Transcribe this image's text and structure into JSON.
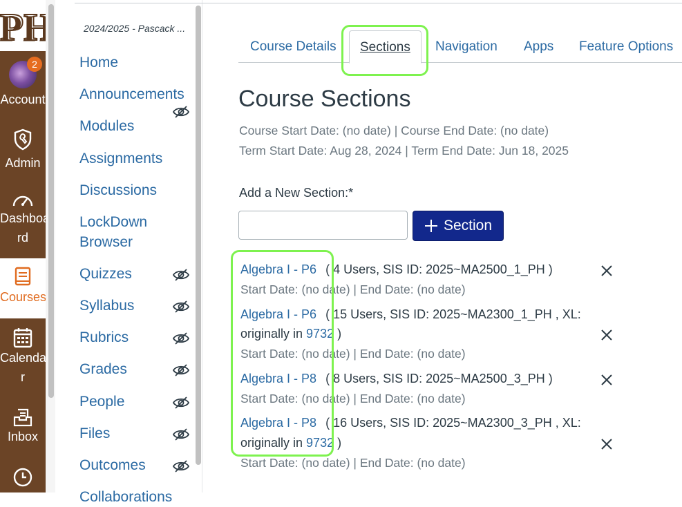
{
  "global_nav": {
    "logo_text": "PH",
    "items": [
      {
        "label": "Account",
        "badge": "2",
        "icon": "avatar"
      },
      {
        "label": "Admin",
        "icon": "shield-icon"
      },
      {
        "label": "Dashboa rd",
        "line1": "Dashboa",
        "line2": "rd",
        "icon": "speedometer-icon"
      },
      {
        "label": "Courses",
        "icon": "book-icon",
        "active": true
      },
      {
        "label": "Calenda r",
        "line1": "Calenda",
        "line2": "r",
        "icon": "calendar-icon"
      },
      {
        "label": "Inbox",
        "icon": "inbox-icon"
      },
      {
        "label": "",
        "icon": "clock-icon"
      }
    ]
  },
  "course_nav": {
    "term": "2024/2025 - Pascack ...",
    "items": [
      {
        "label": "Home",
        "hidden": false
      },
      {
        "label": "Announcements",
        "hidden": true
      },
      {
        "label": "Modules",
        "hidden": false
      },
      {
        "label": "Assignments",
        "hidden": false
      },
      {
        "label": "Discussions",
        "hidden": false
      },
      {
        "label": "LockDown",
        "label2": "Browser",
        "hidden": false
      },
      {
        "label": "Quizzes",
        "hidden": true
      },
      {
        "label": "Syllabus",
        "hidden": true
      },
      {
        "label": "Rubrics",
        "hidden": true
      },
      {
        "label": "Grades",
        "hidden": true
      },
      {
        "label": "People",
        "hidden": true
      },
      {
        "label": "Files",
        "hidden": true
      },
      {
        "label": "Outcomes",
        "hidden": true
      },
      {
        "label": "Collaborations",
        "hidden": false
      }
    ]
  },
  "tabs": [
    {
      "label": "Course Details"
    },
    {
      "label": "Sections",
      "active": true
    },
    {
      "label": "Navigation"
    },
    {
      "label": "Apps"
    },
    {
      "label": "Feature Options"
    }
  ],
  "main": {
    "title": "Course Sections",
    "course_dates": "Course Start Date: (no date) | Course End Date: (no date)",
    "term_dates": "Term Start Date: Aug 28, 2024 | Term End Date: Jun 18, 2025",
    "add_label": "Add a New Section:*",
    "input_value": "",
    "add_button": "Section"
  },
  "sections": [
    {
      "name": "Algebra I - P6",
      "details": "( 4 Users, SIS ID: 2025~MA2500_1_PH )",
      "dates": "Start Date: (no date) | End Date: (no date)"
    },
    {
      "name": "Algebra I - P6",
      "details": "( 15 Users, SIS ID: 2025~MA2300_1_PH , XL:",
      "xl_prefix": "originally in ",
      "xl_link": "9732",
      "xl_suffix": " )",
      "dates": "Start Date: (no date) | End Date: (no date)"
    },
    {
      "name": "Algebra I - P8",
      "details": "( 8 Users, SIS ID: 2025~MA2500_3_PH )",
      "dates": "Start Date: (no date) | End Date: (no date)"
    },
    {
      "name": "Algebra I - P8",
      "details": "( 16 Users, SIS ID: 2025~MA2300_3_PH , XL:",
      "xl_prefix": "originally in ",
      "xl_link": "9732",
      "xl_suffix": " )",
      "dates": "Start Date: (no date) | End Date: (no date)"
    }
  ],
  "colors": {
    "nav_bg": "#6b4426",
    "link": "#2b6aa3",
    "primary_button": "#12288c",
    "highlight": "#7ef24f",
    "active_nav": "#e06b1f"
  }
}
